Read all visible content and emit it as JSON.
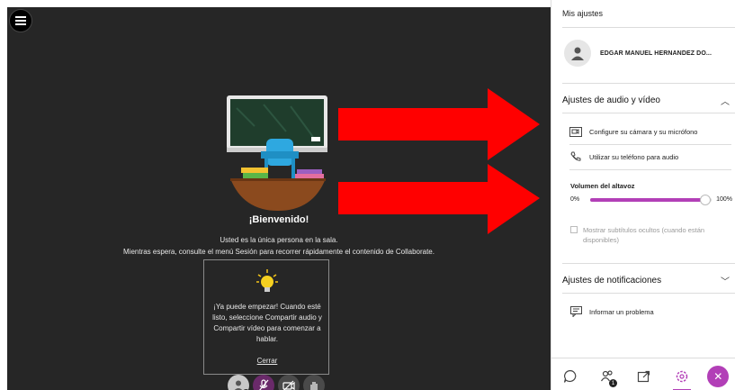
{
  "stage": {
    "welcome_title": "¡Bienvenido!",
    "line1": "Usted es la única persona en la sala.",
    "line2": "Mientras espera, consulte el menú Sesión para recorrer rápidamente el contenido de Collaborate.",
    "tip_text": "¡Ya puede empezar! Cuando esté listo, seleccione Compartir audio y Compartir vídeo para comenzar a hablar.",
    "tip_close": "Cerrar"
  },
  "controls": [
    "avatar",
    "microphone-off-icon",
    "camera-off-icon",
    "hand-raise-icon"
  ],
  "panel": {
    "title": "Mis ajustes",
    "user_name": "EDGAR MANUEL HERNANDEZ DO...",
    "av_section": {
      "title": "Ajustes de audio y vídeo",
      "configure": "Configure su cámara y su micrófono",
      "phone": "Utilizar su teléfono para audio",
      "volume_title": "Volumen del altavoz",
      "volume_min": "0%",
      "volume_max": "100%",
      "volume_level": 0.95,
      "captions": "Mostrar subtítulos ocultos (cuando están disponibles)"
    },
    "notif_section": {
      "title": "Ajustes de notificaciones",
      "report": "Informar un problema"
    },
    "bottom_bar": [
      "chat-icon",
      "participants-icon",
      "share-icon",
      "settings-icon",
      "close-icon"
    ],
    "badge_count": "1"
  },
  "colors": {
    "stage_bg": "#262626",
    "accent": "#b23fb7",
    "arrow": "#ff0000"
  }
}
